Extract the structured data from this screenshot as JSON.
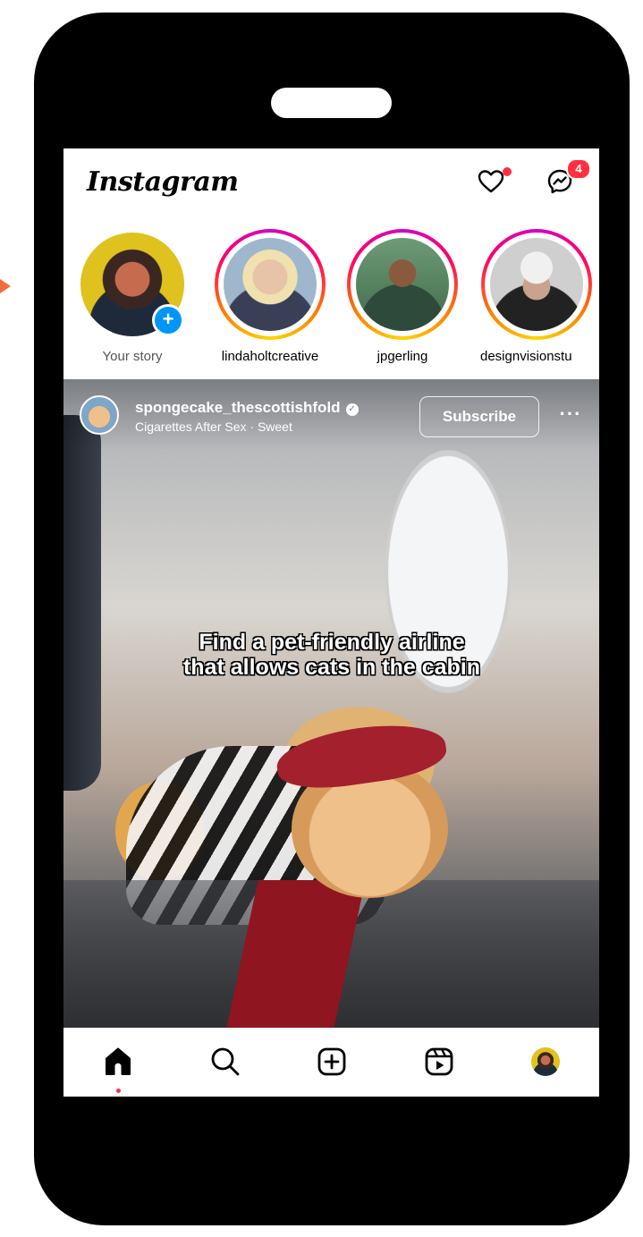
{
  "app": {
    "logo": "Instagram"
  },
  "header": {
    "messenger_badge": "4",
    "heart_has_dot": true
  },
  "stories": [
    {
      "label": "Your story",
      "own": true
    },
    {
      "label": "lindaholtcreative"
    },
    {
      "label": "jpgerling"
    },
    {
      "label": "designvisionstu"
    }
  ],
  "post": {
    "username": "spongecake_thescottishfold",
    "audio": "Cigarettes After Sex · Sweet",
    "subscribe_label": "Subscribe",
    "more_label": "···",
    "caption_line1": "Find a pet-friendly airline",
    "caption_line2": "that allows cats in the cabin"
  },
  "colors": {
    "accent_blue": "#0095f6",
    "notification_red": "#ff3040",
    "story_ring": [
      "#d300c5",
      "#ff0069",
      "#ff7a00",
      "#ffd600"
    ],
    "annotation_arrow": "#f26a3d"
  },
  "icons": {
    "header": [
      "heart-icon",
      "messenger-icon"
    ],
    "bottom_nav": [
      "home-icon",
      "search-icon",
      "create-icon",
      "reels-icon",
      "profile-avatar"
    ]
  }
}
